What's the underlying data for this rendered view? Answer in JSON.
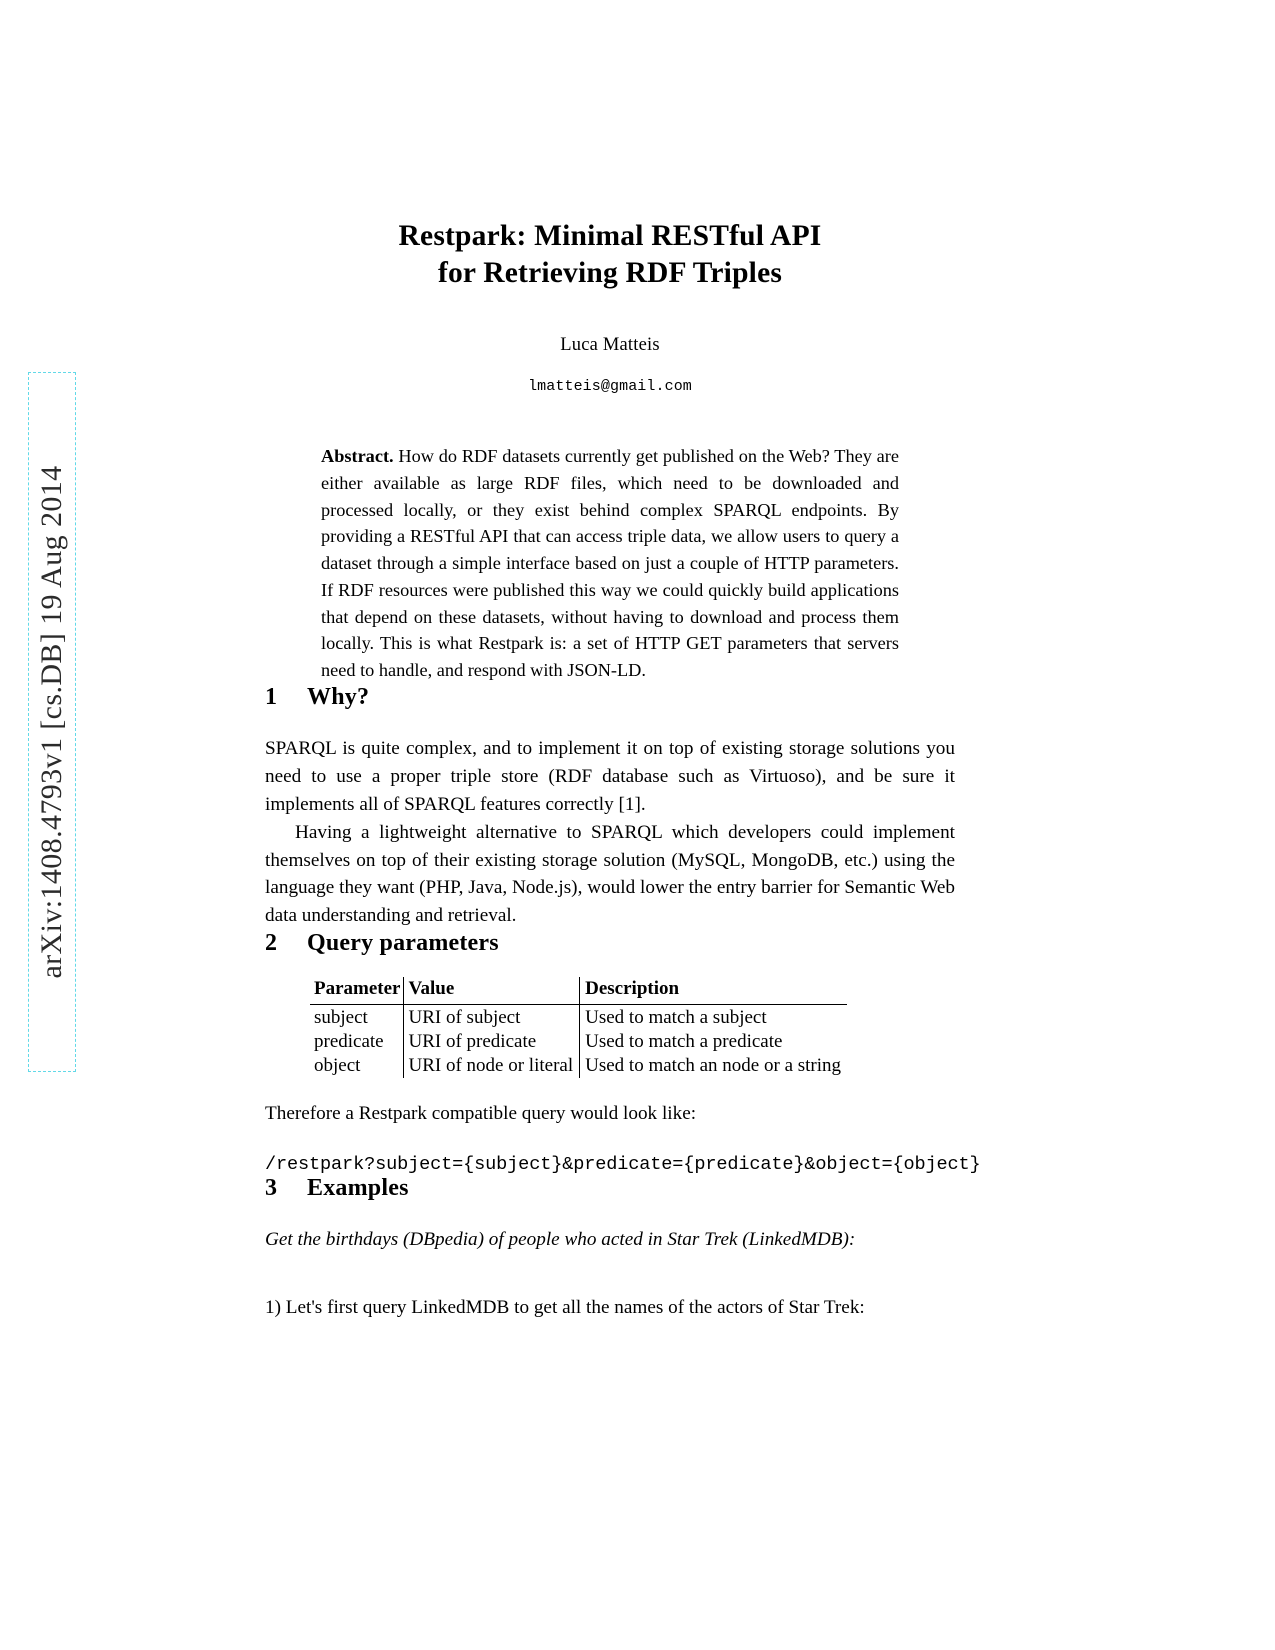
{
  "arxiv_stamp": {
    "text": "arXiv:1408.4793v1  [cs.DB]  19 Aug 2014",
    "border_color": "#62d9e8"
  },
  "paper": {
    "title_line1": "Restpark: Minimal RESTful API",
    "title_line2": "for Retrieving RDF Triples",
    "author": "Luca Matteis",
    "email": "lmatteis@gmail.com",
    "abstract_label": "Abstract.",
    "abstract_text": "How do RDF datasets currently get published on the Web? They are either available as large RDF files, which need to be downloaded and processed locally, or they exist behind complex SPARQL endpoints. By providing a RESTful API that can access triple data, we allow users to query a dataset through a simple interface based on just a couple of HTTP parameters. If RDF resources were published this way we could quickly build applications that depend on these datasets, without having to download and process them locally. This is what Restpark is: a set of HTTP GET parameters that servers need to handle, and respond with JSON-LD."
  },
  "sections": {
    "s1": {
      "number": "1",
      "heading": "Why?",
      "para1": "SPARQL is quite complex, and to implement it on top of existing storage solutions you need to use a proper triple store (RDF database such as Virtuoso), and be sure it implements all of SPARQL features correctly [1].",
      "para2": "Having a lightweight alternative to SPARQL which developers could implement themselves on top of their existing storage solution (MySQL, MongoDB, etc.) using the language they want (PHP, Java, Node.js), would lower the entry barrier for Semantic Web data understanding and retrieval."
    },
    "s2": {
      "number": "2",
      "heading": "Query parameters",
      "after_table_text": "Therefore a Restpark compatible query would look like:",
      "query_template": "/restpark?subject={subject}&predicate={predicate}&object={object}"
    },
    "s3": {
      "number": "3",
      "heading": "Examples",
      "italic_line": "Get the birthdays (DBpedia) of people who acted in Star Trek (LinkedMDB):",
      "step1": "1) Let's first query LinkedMDB to get all the names of the actors of Star Trek:"
    }
  },
  "params_table": {
    "headers": [
      "Parameter",
      "Value",
      "Description"
    ],
    "rows": [
      {
        "parameter": "subject",
        "value": "URI of subject",
        "description": "Used to match a subject"
      },
      {
        "parameter": "predicate",
        "value": "URI of predicate",
        "description": "Used to match a predicate"
      },
      {
        "parameter": "object",
        "value": "URI of node or literal",
        "description": "Used to match an node or a string"
      }
    ]
  }
}
